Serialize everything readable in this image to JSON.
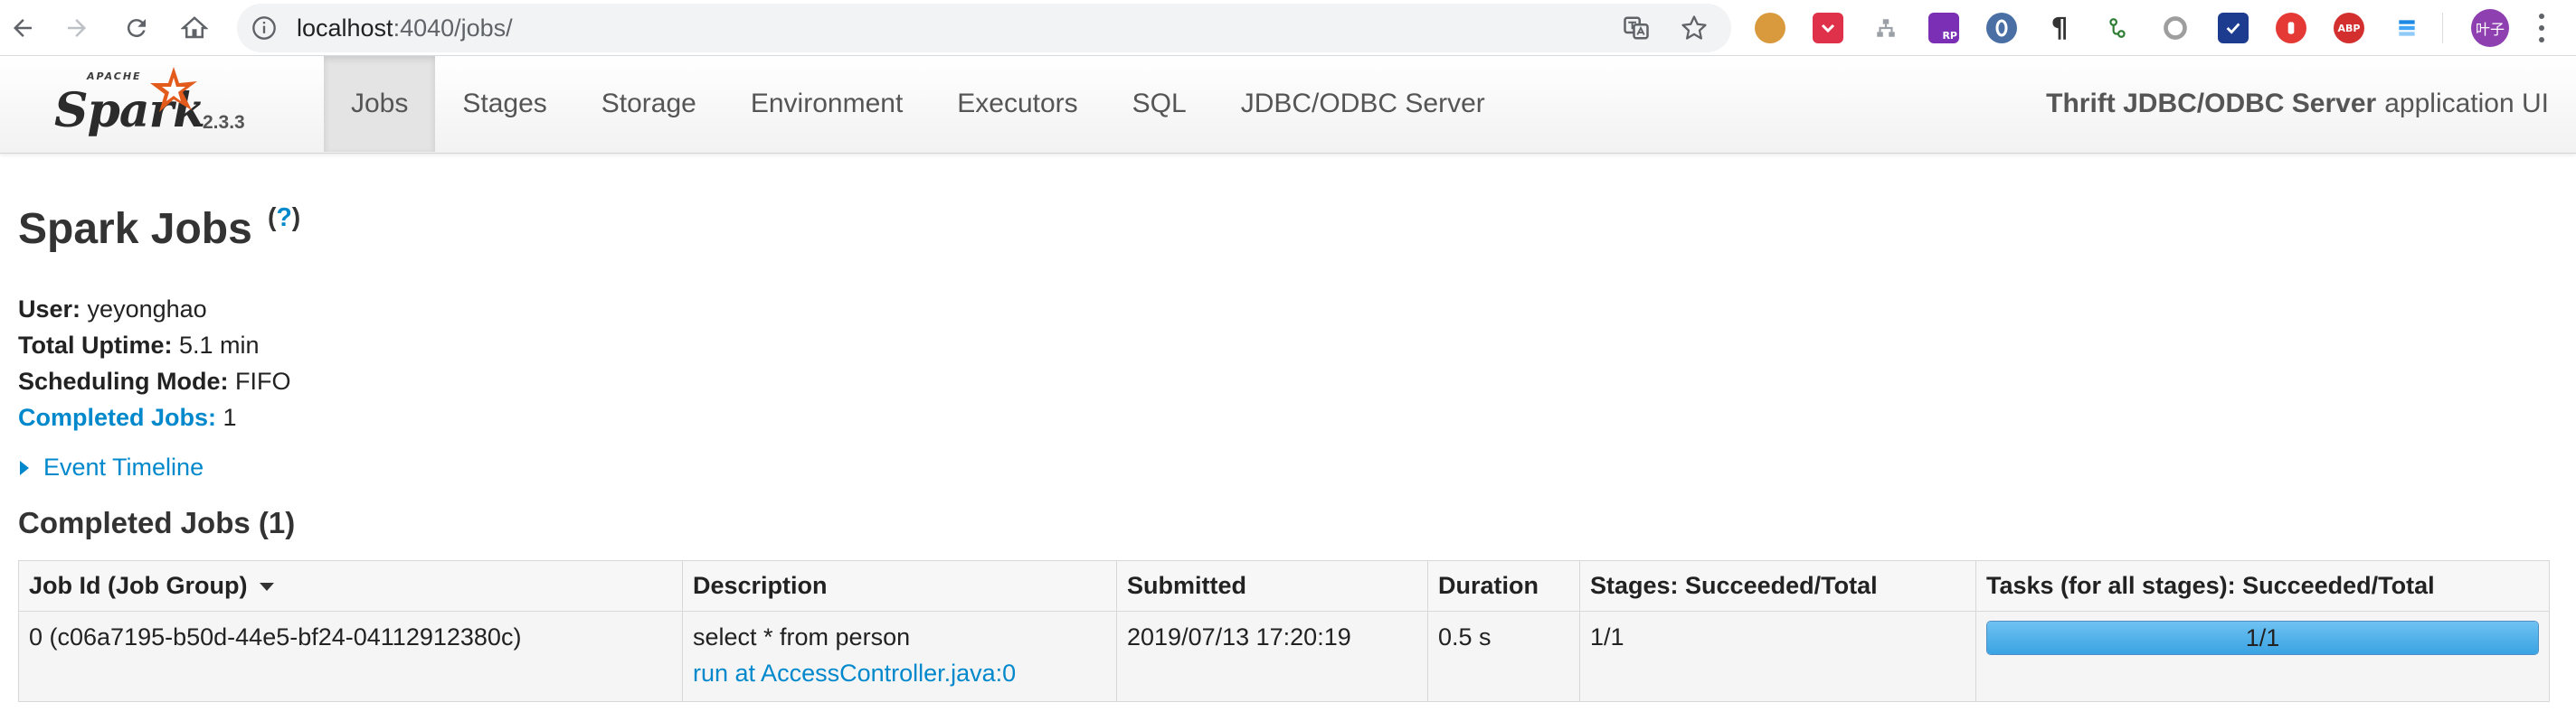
{
  "browser": {
    "url_host": "localhost",
    "url_rest": ":4040/jobs/",
    "extensions": [
      "cookie-icon",
      "pocket-icon",
      "sitemap-icon",
      "rp-icon",
      "opera-icon",
      "pilcrow-icon",
      "git-icon",
      "circle-icon",
      "checkbox-icon",
      "stop-icon",
      "adblock-icon",
      "stack-icon"
    ],
    "extension_labels": {
      "rp": "RP",
      "abp": "ABP"
    },
    "profile_label": "叶子"
  },
  "navbar": {
    "logo_apache": "APACHE",
    "logo_word": "Spark",
    "version": "2.3.3",
    "tabs": [
      {
        "label": "Jobs",
        "active": true
      },
      {
        "label": "Stages",
        "active": false
      },
      {
        "label": "Storage",
        "active": false
      },
      {
        "label": "Environment",
        "active": false
      },
      {
        "label": "Executors",
        "active": false
      },
      {
        "label": "SQL",
        "active": false
      },
      {
        "label": "JDBC/ODBC Server",
        "active": false
      }
    ],
    "app_name": "Thrift JDBC/ODBC Server",
    "app_suffix": "application UI"
  },
  "page": {
    "title": "Spark Jobs",
    "help_open": "(",
    "help_q": "?",
    "help_close": ")",
    "summary": {
      "user_label": "User:",
      "user_value": "yeyonghao",
      "uptime_label": "Total Uptime:",
      "uptime_value": "5.1 min",
      "mode_label": "Scheduling Mode:",
      "mode_value": "FIFO",
      "completed_label": "Completed Jobs:",
      "completed_value": "1"
    },
    "event_timeline": "Event Timeline",
    "section_title": "Completed Jobs (1)"
  },
  "table": {
    "headers": [
      "Job Id (Job Group)",
      "Description",
      "Submitted",
      "Duration",
      "Stages: Succeeded/Total",
      "Tasks (for all stages): Succeeded/Total"
    ],
    "rows": [
      {
        "job_id": "0 (c06a7195-b50d-44e5-bf24-04112912380c)",
        "description": "select * from person",
        "description_link": "run at AccessController.java:0",
        "submitted": "2019/07/13 17:20:19",
        "duration": "0.5 s",
        "stages": "1/1",
        "tasks_label": "1/1",
        "tasks_fraction": 1.0
      }
    ]
  },
  "colors": {
    "link": "#0088cc",
    "progress_fill": "#3aa3e3",
    "active_tab": "#e4e4e4"
  }
}
